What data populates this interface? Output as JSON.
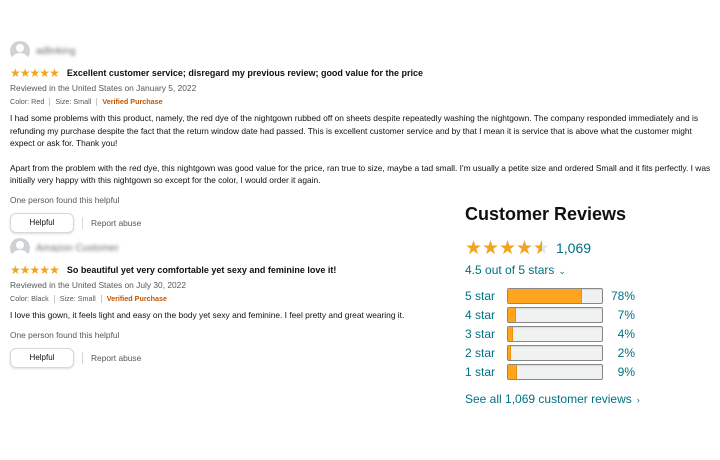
{
  "colors": {
    "star": "#f1a51f",
    "bar_fill": "#ffa41c",
    "link": "#007185",
    "verified": "#c45500"
  },
  "reviews": [
    {
      "reviewer": "adlinking",
      "rating": 5,
      "title": "Excellent customer service; disregard my previous review; good value for the price",
      "meta": "Reviewed in the United States on January 5, 2022",
      "color": "Color: Red",
      "size": "Size: Small",
      "verified": "Verified Purchase",
      "body": [
        "I had some problems with this product, namely, the red dye of the nightgown rubbed off on sheets despite repeatedly washing the nightgown. The company responded immediately and is refunding my purchase despite the fact that the return window date had passed. This is excellent customer service and by that I mean it is service that is above what the customer might expect or ask for. Thank you!",
        "Apart from the problem with the red dye, this nightgown was good value for the price, ran true to size, maybe a tad small. I'm usually a petite size and ordered Small and it fits perfectly. I was initially very happy with this nightgown so except for the color, I would order it again."
      ],
      "helpful_count": "One person found this helpful",
      "helpful_label": "Helpful",
      "report_label": "Report abuse"
    },
    {
      "reviewer": "Amazon Customer",
      "rating": 5,
      "title": "So beautiful yet very comfortable yet sexy and feminine love it!",
      "meta": "Reviewed in the United States on July 30, 2022",
      "color": "Color: Black",
      "size": "Size: Small",
      "verified": "Verified Purchase",
      "body": [
        "I love this gown, it feels light and easy on the body yet sexy and feminine. I feel pretty and great wearing it."
      ],
      "helpful_count": "One person found this helpful",
      "helpful_label": "Helpful",
      "report_label": "Report abuse"
    }
  ],
  "summary": {
    "title": "Customer Reviews",
    "rating_value": 4.5,
    "count": "1,069",
    "out_of": "4.5 out of 5 stars",
    "histogram": [
      {
        "label": "5 star",
        "percent": 78,
        "percent_text": "78%"
      },
      {
        "label": "4 star",
        "percent": 7,
        "percent_text": "7%"
      },
      {
        "label": "3 star",
        "percent": 4,
        "percent_text": "4%"
      },
      {
        "label": "2 star",
        "percent": 2,
        "percent_text": "2%"
      },
      {
        "label": "1 star",
        "percent": 9,
        "percent_text": "9%"
      }
    ],
    "see_all": "See all 1,069 customer reviews"
  }
}
